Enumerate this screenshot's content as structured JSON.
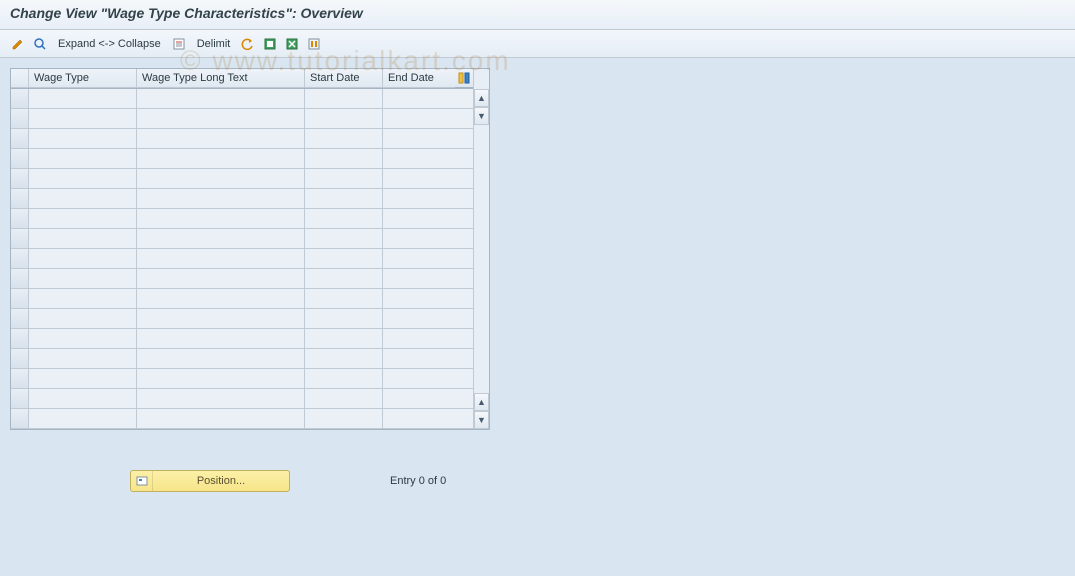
{
  "title": "Change View \"Wage Type Characteristics\": Overview",
  "toolbar": {
    "expand_collapse": "Expand <-> Collapse",
    "delimit": "Delimit"
  },
  "table": {
    "headers": {
      "wage_type": "Wage Type",
      "wage_type_long_text": "Wage Type Long Text",
      "start_date": "Start Date",
      "end_date": "End Date"
    },
    "row_count": 17
  },
  "footer": {
    "position_label": "Position...",
    "entry_text": "Entry 0 of 0"
  },
  "watermark": "© www.tutorialkart.com"
}
